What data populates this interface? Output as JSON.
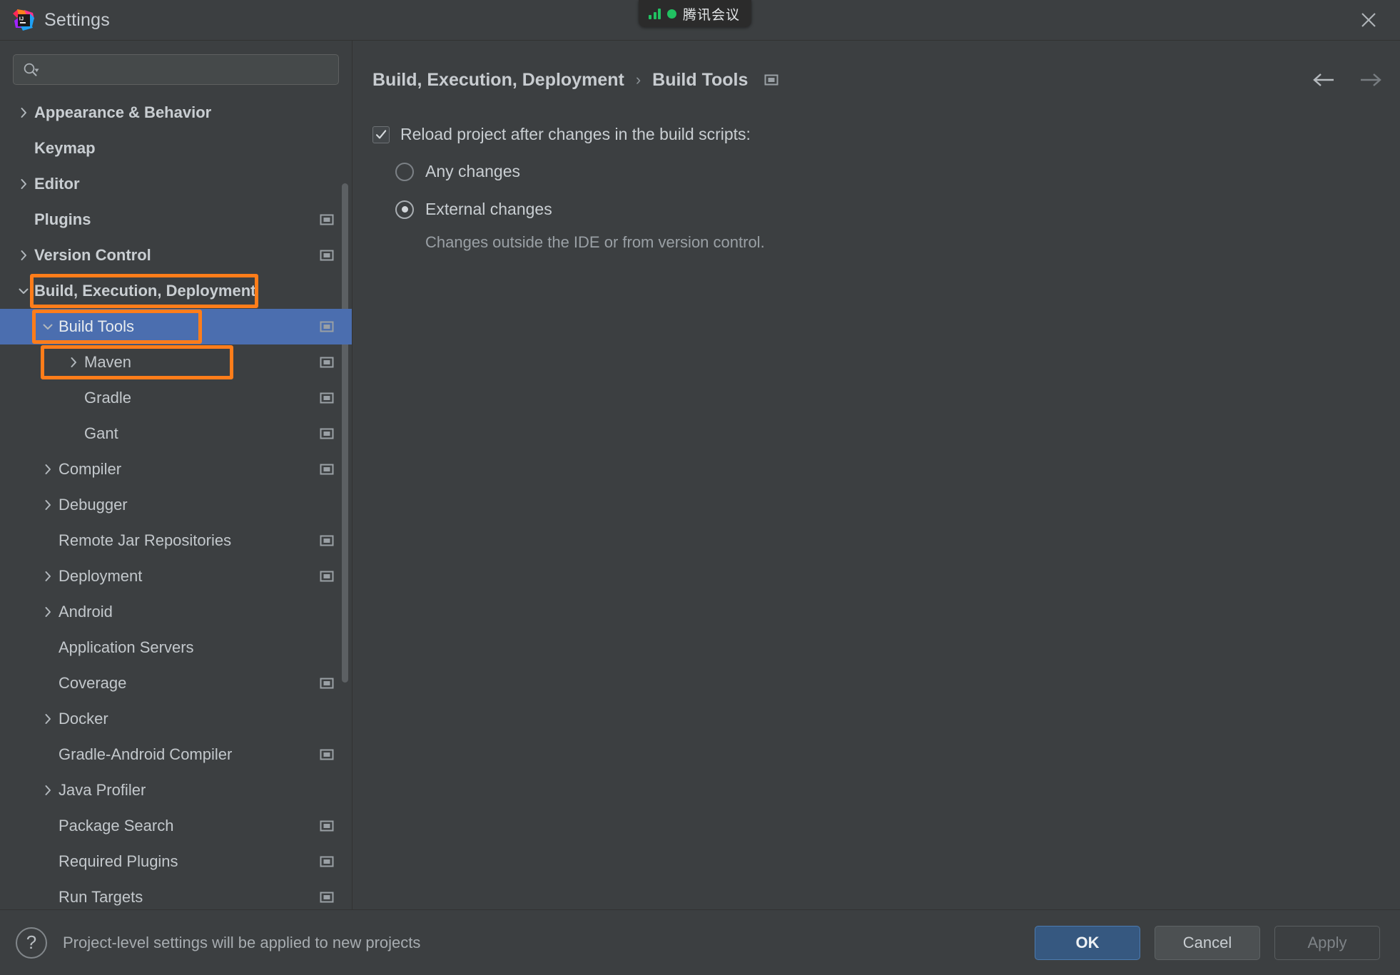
{
  "window": {
    "title": "Settings",
    "logo_icon": "intellij-idea-logo",
    "close_icon": "close-icon"
  },
  "overlay": {
    "meeting_label": "腾讯会议",
    "signal_icon": "signal-bars-icon",
    "status_icon": "status-dot-icon",
    "accent_color": "#21c161"
  },
  "search": {
    "value": "",
    "placeholder": "",
    "icon": "search-icon"
  },
  "sidebar": {
    "items": [
      {
        "label": "Appearance & Behavior",
        "level": 0,
        "twisty": "chevron-right",
        "badge": false,
        "selected": false
      },
      {
        "label": "Keymap",
        "level": 0,
        "twisty": "none",
        "badge": false,
        "selected": false
      },
      {
        "label": "Editor",
        "level": 0,
        "twisty": "chevron-right",
        "badge": false,
        "selected": false
      },
      {
        "label": "Plugins",
        "level": 0,
        "twisty": "none",
        "badge": true,
        "selected": false
      },
      {
        "label": "Version Control",
        "level": 0,
        "twisty": "chevron-right",
        "badge": true,
        "selected": false
      },
      {
        "label": "Build, Execution, Deployment",
        "level": 0,
        "twisty": "chevron-down",
        "badge": false,
        "selected": false
      },
      {
        "label": "Build Tools",
        "level": 1,
        "twisty": "chevron-down",
        "badge": true,
        "selected": true
      },
      {
        "label": "Maven",
        "level": 2,
        "twisty": "chevron-right",
        "badge": true,
        "selected": false
      },
      {
        "label": "Gradle",
        "level": 2,
        "twisty": "none",
        "badge": true,
        "selected": false
      },
      {
        "label": "Gant",
        "level": 2,
        "twisty": "none",
        "badge": true,
        "selected": false
      },
      {
        "label": "Compiler",
        "level": 1,
        "twisty": "chevron-right",
        "badge": true,
        "selected": false
      },
      {
        "label": "Debugger",
        "level": 1,
        "twisty": "chevron-right",
        "badge": false,
        "selected": false
      },
      {
        "label": "Remote Jar Repositories",
        "level": 1,
        "twisty": "none",
        "badge": true,
        "selected": false
      },
      {
        "label": "Deployment",
        "level": 1,
        "twisty": "chevron-right",
        "badge": true,
        "selected": false
      },
      {
        "label": "Android",
        "level": 1,
        "twisty": "chevron-right",
        "badge": false,
        "selected": false
      },
      {
        "label": "Application Servers",
        "level": 1,
        "twisty": "none",
        "badge": false,
        "selected": false
      },
      {
        "label": "Coverage",
        "level": 1,
        "twisty": "none",
        "badge": true,
        "selected": false
      },
      {
        "label": "Docker",
        "level": 1,
        "twisty": "chevron-right",
        "badge": false,
        "selected": false
      },
      {
        "label": "Gradle-Android Compiler",
        "level": 1,
        "twisty": "none",
        "badge": true,
        "selected": false
      },
      {
        "label": "Java Profiler",
        "level": 1,
        "twisty": "chevron-right",
        "badge": false,
        "selected": false
      },
      {
        "label": "Package Search",
        "level": 1,
        "twisty": "none",
        "badge": true,
        "selected": false
      },
      {
        "label": "Required Plugins",
        "level": 1,
        "twisty": "none",
        "badge": true,
        "selected": false
      },
      {
        "label": "Run Targets",
        "level": 1,
        "twisty": "none",
        "badge": true,
        "selected": false
      }
    ],
    "selection_color": "#4b6eaf",
    "annotation_color": "#ff7d1a",
    "annotations": [
      {
        "target": "Build, Execution, Deployment"
      },
      {
        "target": "Build Tools"
      },
      {
        "target": "Maven"
      }
    ]
  },
  "breadcrumb": {
    "root": "Build, Execution, Deployment",
    "separator": "›",
    "current": "Build Tools",
    "badge_icon": "project-level-settings-icon",
    "back_icon": "arrow-left-icon",
    "forward_icon": "arrow-right-icon"
  },
  "main": {
    "reload_checkbox": {
      "label": "Reload project after changes in the build scripts:",
      "checked": true
    },
    "reload_options": [
      {
        "label": "Any changes",
        "selected": false,
        "hint": ""
      },
      {
        "label": "External changes",
        "selected": true,
        "hint": "Changes outside the IDE or from version control."
      }
    ]
  },
  "footer": {
    "help_icon": "help-icon",
    "help_glyph": "?",
    "note": "Project-level settings will be applied to new projects",
    "buttons": [
      {
        "label": "OK",
        "style": "primary",
        "enabled": true
      },
      {
        "label": "Cancel",
        "style": "normal",
        "enabled": true
      },
      {
        "label": "Apply",
        "style": "disabled",
        "enabled": false
      }
    ]
  }
}
